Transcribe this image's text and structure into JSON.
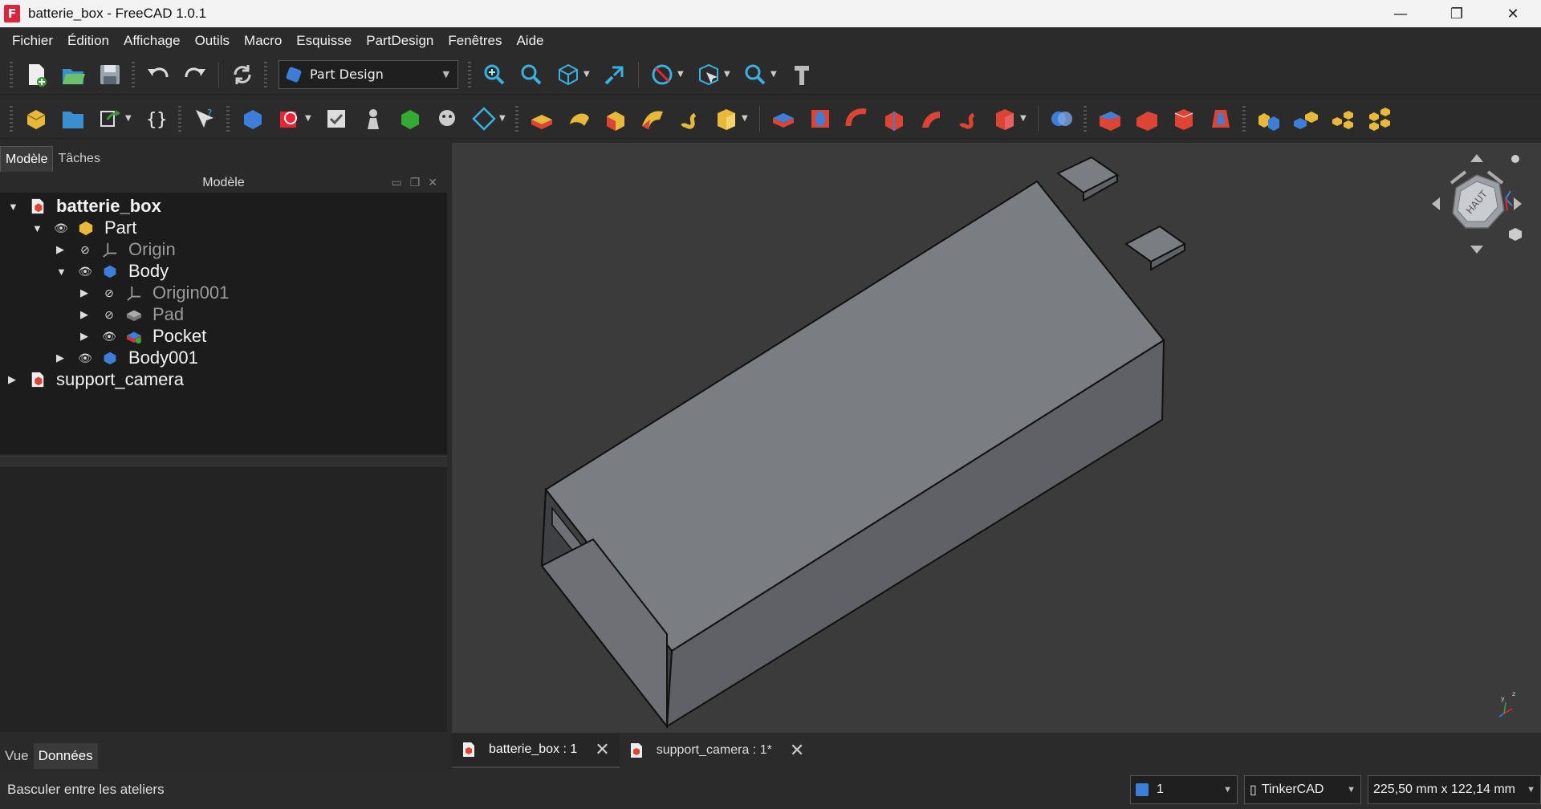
{
  "window": {
    "title": "batterie_box - FreeCAD 1.0.1",
    "app_icon": "F",
    "minimize": "—",
    "restore": "❐",
    "close": "✕"
  },
  "menu": [
    "Fichier",
    "Édition",
    "Affichage",
    "Outils",
    "Macro",
    "Esquisse",
    "PartDesign",
    "Fenêtres",
    "Aide"
  ],
  "workbench": {
    "selected": "Part Design"
  },
  "left_panel": {
    "tabs": [
      "Modèle",
      "Tâches"
    ],
    "header": "Modèle",
    "tree": [
      {
        "label": "batterie_box",
        "bold": true
      },
      {
        "label": "Part"
      },
      {
        "label": "Origin",
        "dim": true
      },
      {
        "label": "Body"
      },
      {
        "label": "Origin001",
        "dim": true
      },
      {
        "label": "Pad",
        "dim": true
      },
      {
        "label": "Pocket"
      },
      {
        "label": "Body001"
      },
      {
        "label": "support_camera"
      }
    ],
    "bottom_tabs": [
      "Vue",
      "Données"
    ]
  },
  "doc_tabs": [
    {
      "label": "batterie_box : 1",
      "active": true
    },
    {
      "label": "support_camera : 1*",
      "active": false
    }
  ],
  "navcube": {
    "face_label": "HAUT"
  },
  "status": {
    "message": "Basculer entre les ateliers",
    "layer": "1",
    "nav_style": "TinkerCAD",
    "dimensions": "225,50 mm x 122,14 mm"
  },
  "colors": {
    "model_top": "#7a7d82",
    "model_side": "#5f6166",
    "viewport_bg": "#3b3b3b",
    "accent_blue": "#3d7fd8"
  }
}
